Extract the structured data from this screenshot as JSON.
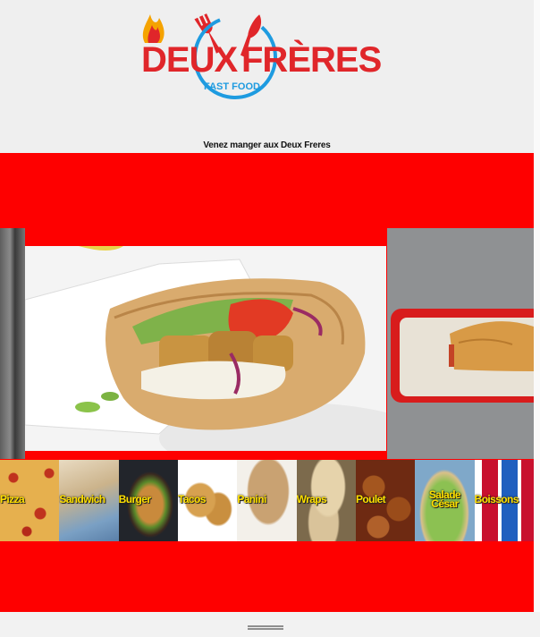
{
  "brand": {
    "name_part1": "DEUX",
    "name_part2": "FRÈRES",
    "subtitle": "FAST FOOD"
  },
  "tagline": "Venez manger aux Deux Freres",
  "colors": {
    "brand_red": "#fe0000",
    "logo_red": "#e0262a",
    "logo_blue": "#1e9be0",
    "label_yellow": "#ffe000"
  },
  "carousel": {
    "slides": [
      "side-dish",
      "chicken-pita-wrap",
      "panini-tray"
    ]
  },
  "categories": [
    {
      "label": "Pizza"
    },
    {
      "label": "Sandwich"
    },
    {
      "label": "Burger"
    },
    {
      "label": "Tacos"
    },
    {
      "label": "Panini"
    },
    {
      "label": "Wraps"
    },
    {
      "label": "Poulet"
    },
    {
      "label": "Salade César"
    },
    {
      "label": "Boissons"
    }
  ]
}
